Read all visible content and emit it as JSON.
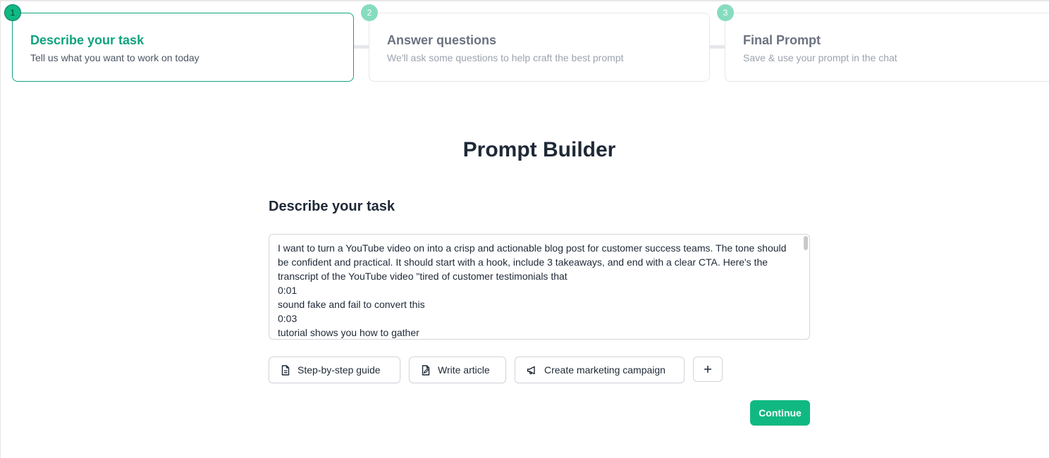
{
  "stepper": {
    "steps": [
      {
        "number": "1",
        "title": "Describe your task",
        "subtitle": "Tell us what you want to work on today",
        "state": "active"
      },
      {
        "number": "2",
        "title": "Answer questions",
        "subtitle": "We'll ask some questions to help craft the best prompt",
        "state": "inactive"
      },
      {
        "number": "3",
        "title": "Final Prompt",
        "subtitle": "Save & use your prompt in the chat",
        "state": "inactive"
      }
    ]
  },
  "page": {
    "title": "Prompt Builder",
    "section_title": "Describe your task"
  },
  "task_input": {
    "value": "I want to turn a YouTube video on into a crisp and actionable blog post for customer success teams. The tone should be confident and practical. It should start with a hook, include 3 takeaways, and end with a clear CTA. Here's the transcript of the YouTube video \"tired of customer testimonials that\n0:01\nsound fake and fail to convert this\n0:03\ntutorial shows you how to gather"
  },
  "templates": [
    {
      "label": "Step-by-step guide",
      "icon": "document-icon"
    },
    {
      "label": "Write article",
      "icon": "edit-document-icon"
    },
    {
      "label": "Create marketing campaign",
      "icon": "megaphone-icon"
    }
  ],
  "add_template": {
    "label": "+"
  },
  "actions": {
    "continue_label": "Continue"
  },
  "colors": {
    "accent": "#10b981",
    "accent_text": "#10a37f",
    "inactive_badge": "#86dcbf"
  }
}
